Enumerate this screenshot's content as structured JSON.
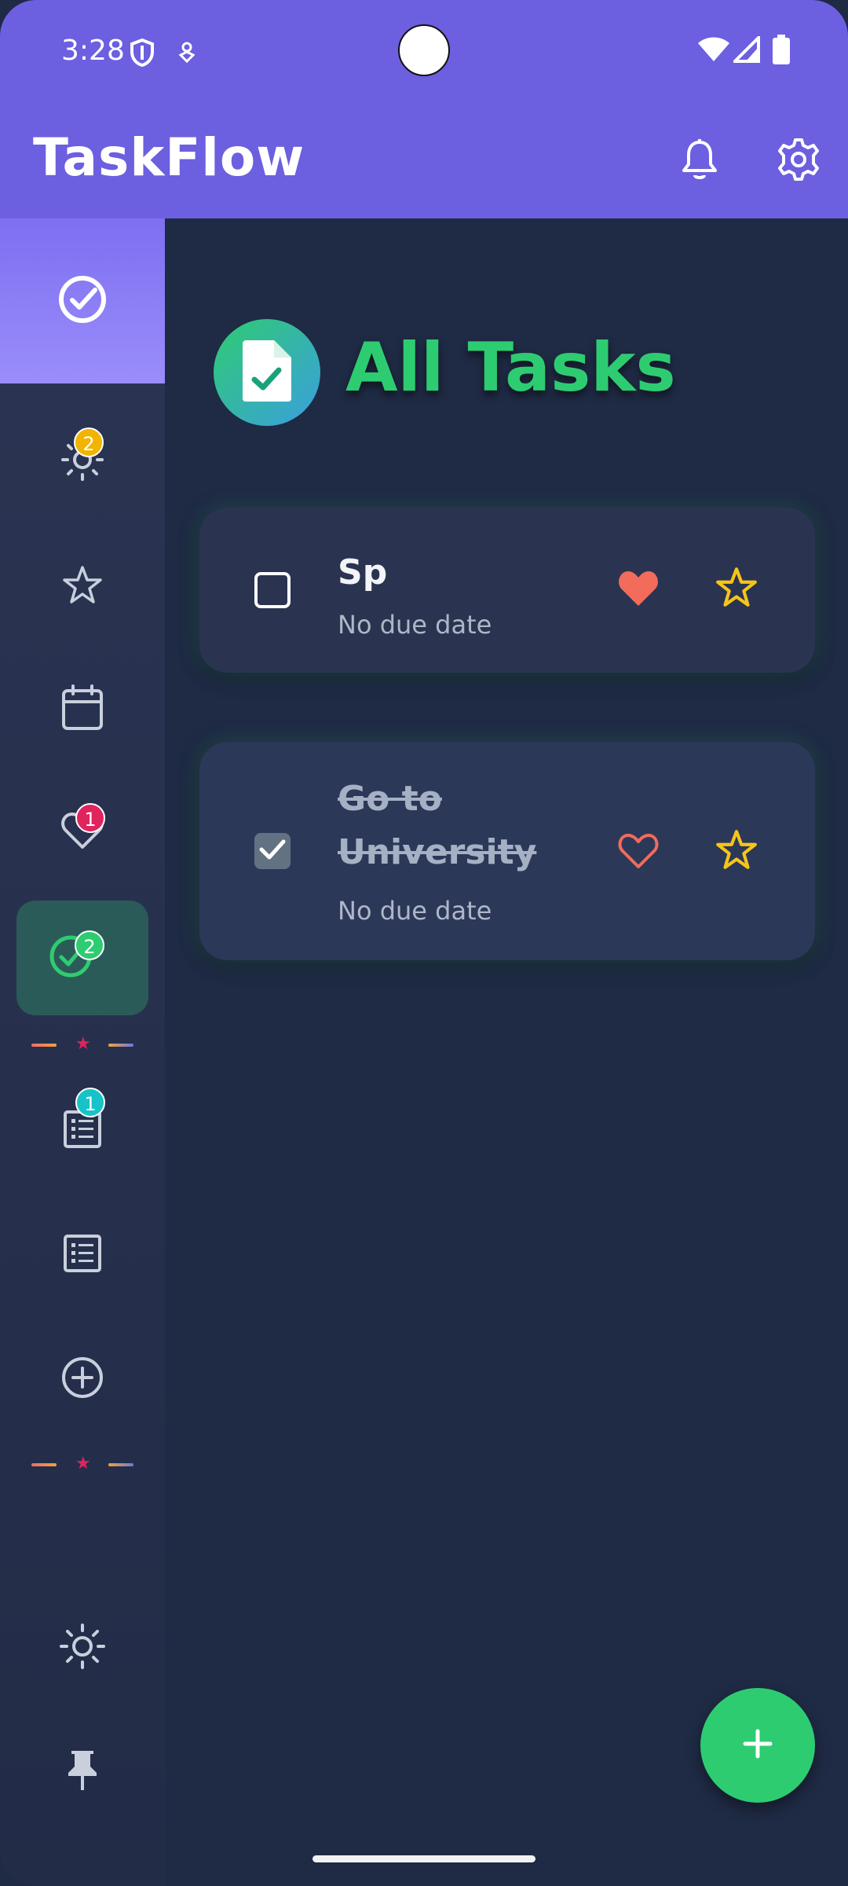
{
  "status_bar": {
    "time": "3:28"
  },
  "app_bar": {
    "title": "TaskFlow"
  },
  "sidebar": {
    "badges": {
      "today": "2",
      "favorites": "1",
      "completed": "2",
      "lists": "1"
    }
  },
  "main": {
    "title": "All Tasks",
    "tasks": [
      {
        "title": "Sp",
        "due": "No due date",
        "completed": false,
        "favorite": true,
        "starred": false
      },
      {
        "title_line1": "Go to",
        "title_line2": "University",
        "due": "No due date",
        "completed": true,
        "favorite": false,
        "starred": false
      }
    ]
  },
  "colors": {
    "app_bar": "#6c5fe0",
    "background": "#1f2a44",
    "accent_green": "#2ecc71",
    "heart": "#f26b5b",
    "star": "#f5c518"
  },
  "fab": {
    "label": "+"
  }
}
